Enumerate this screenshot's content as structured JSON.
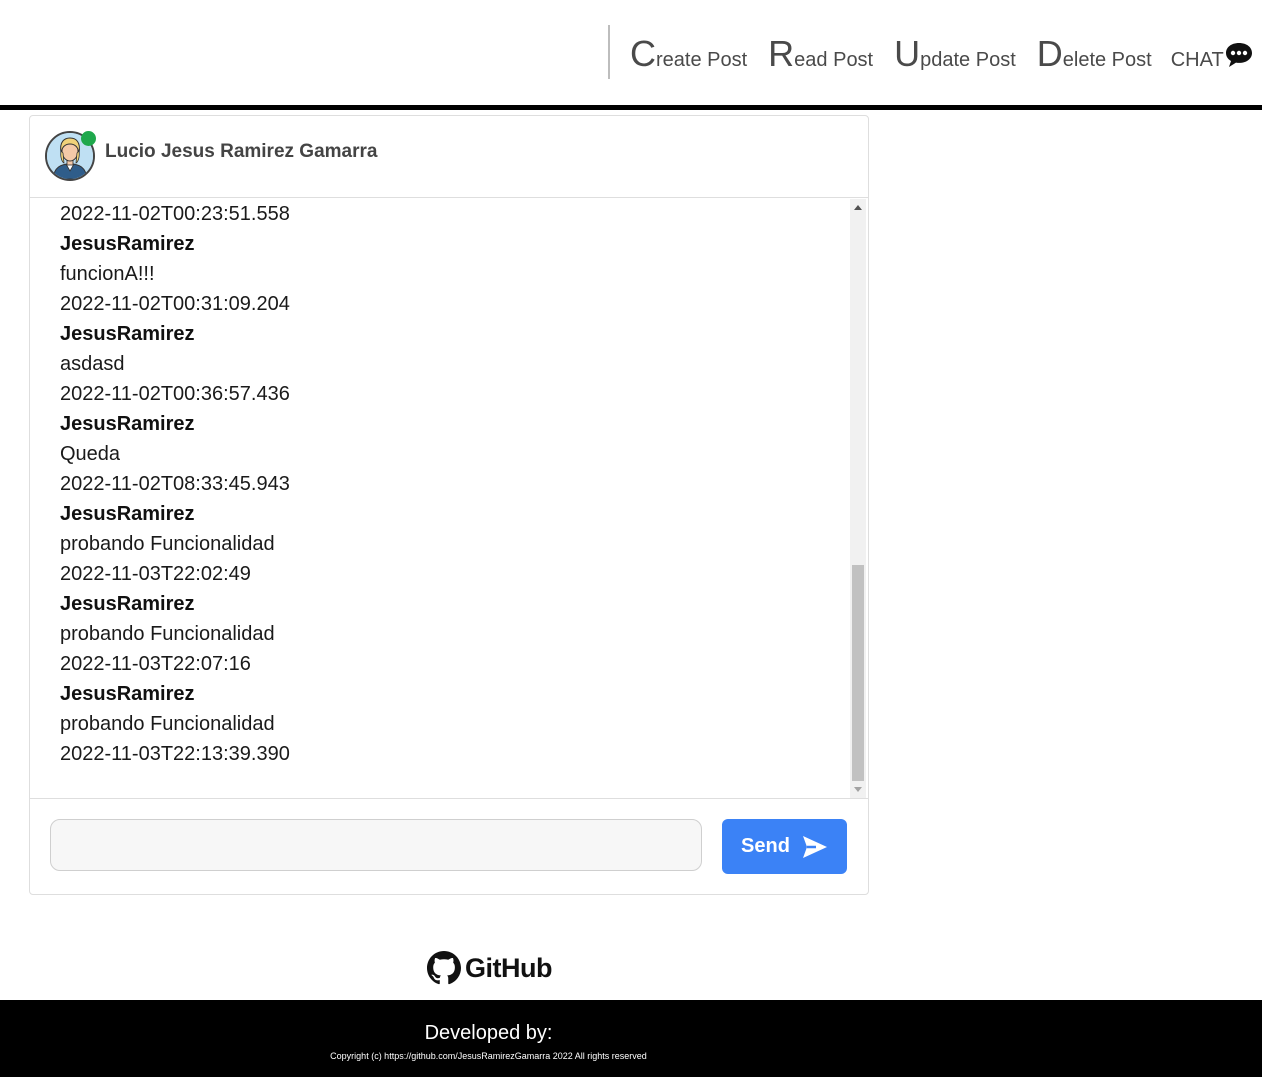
{
  "nav": {
    "links": [
      {
        "initial": "C",
        "rest": "reate Post"
      },
      {
        "initial": "R",
        "rest": "ead Post"
      },
      {
        "initial": "U",
        "rest": "pdate Post"
      },
      {
        "initial": "D",
        "rest": "elete Post"
      }
    ],
    "chat_label": "CHAT",
    "chat_icon": "chat-bubble-icon"
  },
  "chat": {
    "contact_name": "Lucio Jesus Ramirez Gamarra",
    "status_color": "#1fa84c",
    "messages": [
      {
        "type": "time",
        "text": "2022-11-02T00:23:51.558"
      },
      {
        "type": "user",
        "text": "JesusRamirez"
      },
      {
        "type": "text",
        "text": "funcionA!!!"
      },
      {
        "type": "time",
        "text": "2022-11-02T00:31:09.204"
      },
      {
        "type": "user",
        "text": "JesusRamirez"
      },
      {
        "type": "text",
        "text": "asdasd"
      },
      {
        "type": "time",
        "text": "2022-11-02T00:36:57.436"
      },
      {
        "type": "user",
        "text": "JesusRamirez"
      },
      {
        "type": "text",
        "text": "Queda"
      },
      {
        "type": "time",
        "text": "2022-11-02T08:33:45.943"
      },
      {
        "type": "user",
        "text": "JesusRamirez"
      },
      {
        "type": "text",
        "text": "probando Funcionalidad"
      },
      {
        "type": "time",
        "text": "2022-11-03T22:02:49"
      },
      {
        "type": "user",
        "text": "JesusRamirez"
      },
      {
        "type": "text",
        "text": "probando Funcionalidad"
      },
      {
        "type": "time",
        "text": "2022-11-03T22:07:16"
      },
      {
        "type": "user",
        "text": "JesusRamirez"
      },
      {
        "type": "text",
        "text": "probando Funcionalidad"
      },
      {
        "type": "time",
        "text": "2022-11-03T22:13:39.390"
      }
    ],
    "input": {
      "value": "",
      "placeholder": ""
    },
    "send_label": "Send",
    "send_color": "#3b82f6"
  },
  "github": {
    "label": "GitHub"
  },
  "footer": {
    "developed_by": "Developed by:",
    "copyright": "Copyright (c) https://github.com/JesusRamirezGamarra 2022 All rights reserved"
  }
}
